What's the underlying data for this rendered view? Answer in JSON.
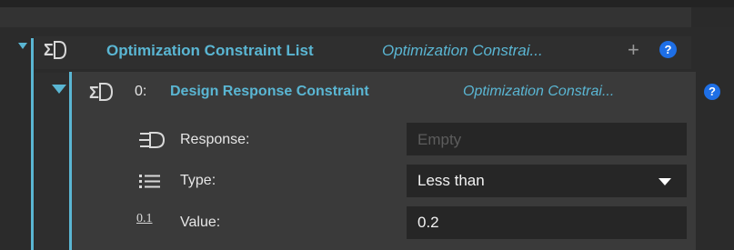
{
  "constraint_list": {
    "title": "Optimization Constraint List",
    "type_label": "Optimization Constrai...",
    "add_icon": "plus-icon",
    "help_label": "?"
  },
  "item": {
    "index": "0:",
    "title": "Design Response Constraint",
    "type_label": "Optimization Constrai...",
    "help_label": "?"
  },
  "properties": {
    "response": {
      "label": "Response:",
      "placeholder": "Empty",
      "value": ""
    },
    "type": {
      "label": "Type:",
      "selected": "Less than"
    },
    "value": {
      "icon_text": "0.1",
      "label": "Value:",
      "value": "0.2"
    }
  },
  "colors": {
    "accent": "#5ab6d3",
    "help_blue": "#1e6fe6",
    "panel": "#3a3a3a",
    "field": "#262626"
  }
}
